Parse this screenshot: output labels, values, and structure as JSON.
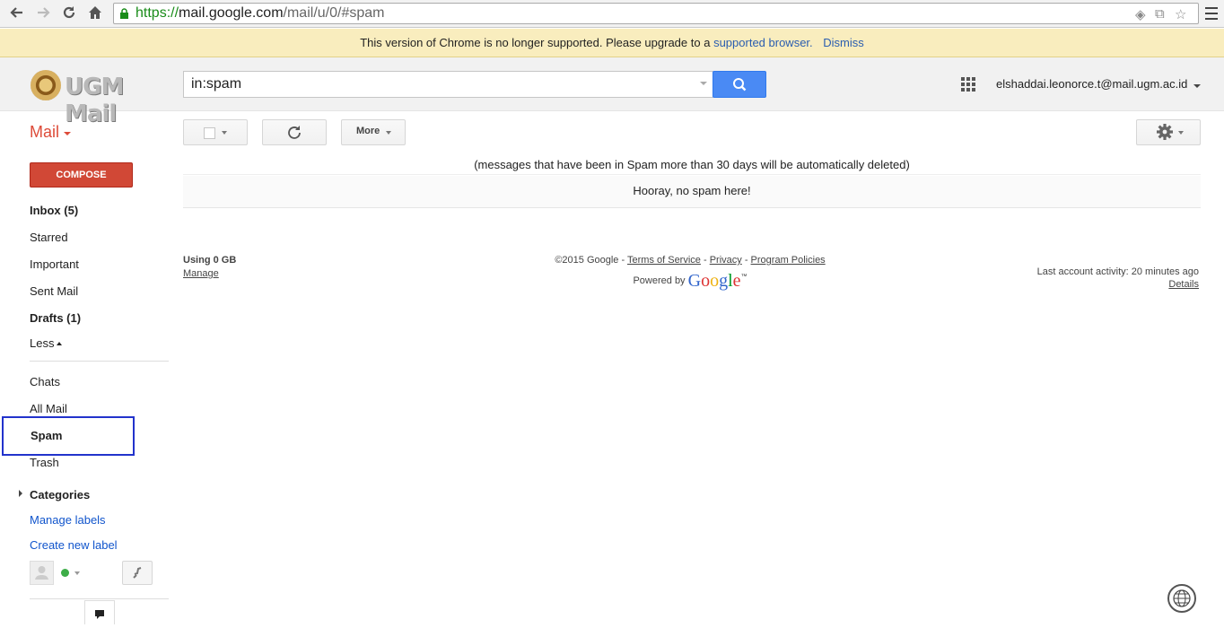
{
  "browser": {
    "url_scheme": "https://",
    "url_host": "mail.google.com",
    "url_path": "/mail/u/0/#spam",
    "back_icon": "back-arrow-icon",
    "forward_icon": "forward-arrow-icon",
    "reload_icon": "reload-icon",
    "home_icon": "home-icon"
  },
  "infobar": {
    "message": "This version of Chrome is no longer supported. Please upgrade to a",
    "link": "supported browser.",
    "dismiss": "Dismiss"
  },
  "header": {
    "logo_text": "UGM Mail",
    "search_value": "in:spam",
    "account": "elshaddai.leonorce.t@mail.ugm.ac.id"
  },
  "toolbar": {
    "mail_label": "Mail",
    "more_label": "More"
  },
  "sidebar": {
    "compose": "COMPOSE",
    "items": [
      {
        "label": "Inbox (5)"
      },
      {
        "label": "Starred"
      },
      {
        "label": "Important"
      },
      {
        "label": "Sent Mail"
      },
      {
        "label": "Drafts (1)"
      },
      {
        "label": "Less"
      },
      {
        "label": "Chats"
      },
      {
        "label": "All Mail"
      },
      {
        "label": "Spam"
      },
      {
        "label": "Trash"
      },
      {
        "label": "Categories"
      },
      {
        "label": "Manage labels"
      },
      {
        "label": "Create new label"
      }
    ]
  },
  "main": {
    "notice": "(messages that have been in Spam more than 30 days will be automatically deleted)",
    "empty_message": "Hooray, no spam here!"
  },
  "footer": {
    "usage": "Using 0 GB",
    "manage": "Manage",
    "copyright": "©2015 Google - ",
    "terms": "Terms of Service",
    "sep1": " - ",
    "privacy": "Privacy",
    "sep2": " - ",
    "policies": "Program Policies",
    "powered_by": "Powered by ",
    "google": "Google",
    "tm": "™",
    "last_activity": "Last account activity: 20 minutes ago",
    "details": "Details"
  },
  "colors": {
    "accent_red": "#dd4b39",
    "compose_red": "#d14836",
    "search_blue": "#4a8af4",
    "link_blue": "#1155cc",
    "highlight_blue": "#2233cc"
  }
}
